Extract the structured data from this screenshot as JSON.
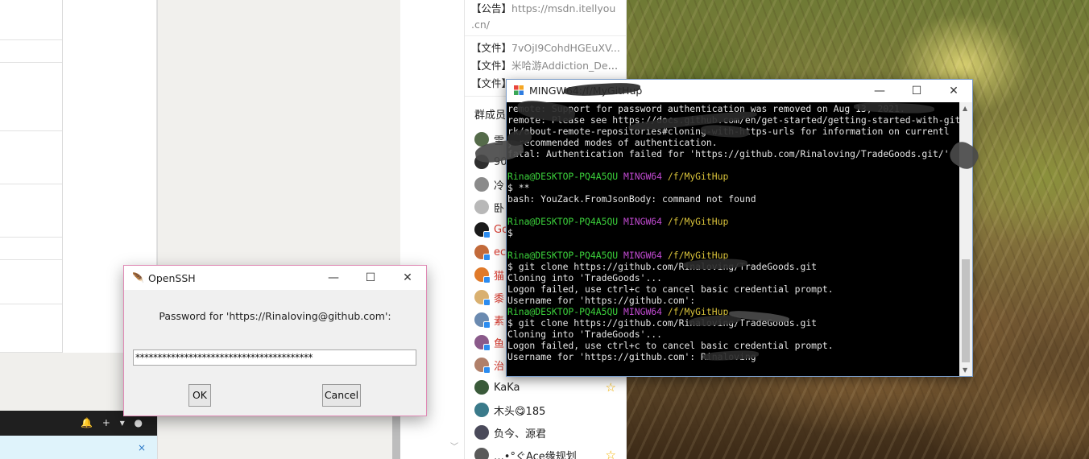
{
  "qq_panel": {
    "announcement": {
      "tag": "【公告】",
      "value": "https://msdn.itellyou",
      "cont": ".cn/"
    },
    "files": [
      {
        "tag": "【文件】",
        "value": "7vOjI9CohdHGEuXV..."
      },
      {
        "tag": "【文件】",
        "value": "米哈游Addiction_Dem..."
      },
      {
        "tag": "【文件】",
        "value": ""
      }
    ],
    "members_title": "群成员",
    "members": [
      {
        "name": "雪",
        "red": false,
        "color": "#556b4a",
        "dot": false,
        "star": false
      },
      {
        "name": "90",
        "red": false,
        "color": "#2e2e2e",
        "dot": false,
        "star": false
      },
      {
        "name": "冷",
        "red": false,
        "color": "#8a8a8a",
        "dot": false,
        "star": false
      },
      {
        "name": "卧",
        "red": false,
        "color": "#b8b8b8",
        "dot": false,
        "star": false
      },
      {
        "name": "Go",
        "red": true,
        "color": "#1a1a1a",
        "dot": true,
        "star": false
      },
      {
        "name": "ec",
        "red": true,
        "color": "#c26a3a",
        "dot": true,
        "star": false
      },
      {
        "name": "猫",
        "red": true,
        "color": "#e07a2a",
        "dot": true,
        "star": false
      },
      {
        "name": "黍",
        "red": true,
        "color": "#d9b070",
        "dot": true,
        "star": false
      },
      {
        "name": "素",
        "red": true,
        "color": "#6a8ab0",
        "dot": true,
        "star": false
      },
      {
        "name": "鱼",
        "red": true,
        "color": "#8a5a8a",
        "dot": true,
        "star": false
      },
      {
        "name": "治",
        "red": true,
        "color": "#b0806a",
        "dot": true,
        "star": false
      },
      {
        "name": "KaKa",
        "red": false,
        "color": "#3a5a3a",
        "dot": false,
        "star": true
      },
      {
        "name": "木头😋185",
        "red": false,
        "color": "#3a7a8a",
        "dot": false,
        "star": false
      },
      {
        "name": "负今、源君",
        "red": false,
        "color": "#4a4a5a",
        "dot": false,
        "star": false
      },
      {
        "name": "‥.•°ぐAce缘规划",
        "red": false,
        "color": "#5a5a5a",
        "dot": false,
        "star": true
      }
    ]
  },
  "terminal": {
    "title": "MINGW64:/f/MyGitHup",
    "controls": {
      "minimize": "—",
      "maximize": "☐",
      "close": "✕"
    },
    "lines": [
      {
        "segs": [
          {
            "t": "remote: Support for password authentication was removed on Aug 13, 2021.",
            "c": ""
          }
        ]
      },
      {
        "segs": [
          {
            "t": "remote: Please see https://docs.github.com/en/get-started/getting-started-with-git/about-remote-repositories#cloning-with-https-urls for information on currently",
            "c": ""
          }
        ]
      },
      {
        "segs": [
          {
            "t": "rk/about-remote-repositories#cloning-with-https-urls for information on currentl",
            "c": ""
          }
        ]
      },
      {
        "segs": [
          {
            "t": "y recommended modes of authentication.",
            "c": ""
          }
        ]
      },
      {
        "segs": [
          {
            "t": "fatal: Authentication failed for 'https://github.com/Rinaloving/TradeGoods.git/'",
            "c": ""
          }
        ]
      },
      {
        "segs": [
          {
            "t": "",
            "c": ""
          }
        ]
      },
      {
        "segs": [
          {
            "t": "Rina@DESKTOP-PQ4A5QU ",
            "c": "t-green"
          },
          {
            "t": "MINGW64 ",
            "c": "t-purple"
          },
          {
            "t": "/f/MyGitHup",
            "c": "t-yellow"
          }
        ]
      },
      {
        "segs": [
          {
            "t": "$ **",
            "c": ""
          }
        ]
      },
      {
        "segs": [
          {
            "t": "bash: YouZack.FromJsonBody: command not found",
            "c": ""
          }
        ]
      },
      {
        "segs": [
          {
            "t": "",
            "c": ""
          }
        ]
      },
      {
        "segs": [
          {
            "t": "Rina@DESKTOP-PQ4A5QU ",
            "c": "t-green"
          },
          {
            "t": "MINGW64 ",
            "c": "t-purple"
          },
          {
            "t": "/f/MyGitHup",
            "c": "t-yellow"
          }
        ]
      },
      {
        "segs": [
          {
            "t": "$",
            "c": ""
          }
        ]
      },
      {
        "segs": [
          {
            "t": "",
            "c": ""
          }
        ]
      },
      {
        "segs": [
          {
            "t": "Rina@DESKTOP-PQ4A5QU ",
            "c": "t-green"
          },
          {
            "t": "MINGW64 ",
            "c": "t-purple"
          },
          {
            "t": "/f/MyGitHup",
            "c": "t-yellow"
          }
        ]
      },
      {
        "segs": [
          {
            "t": "$ git clone https://github.com/Rinaloving/TradeGoods.git",
            "c": ""
          }
        ]
      },
      {
        "segs": [
          {
            "t": "Cloning into 'TradeGoods'...",
            "c": ""
          }
        ]
      },
      {
        "segs": [
          {
            "t": "Logon failed, use ctrl+c to cancel basic credential prompt.",
            "c": ""
          }
        ]
      },
      {
        "segs": [
          {
            "t": "Username for 'https://github.com':",
            "c": ""
          }
        ]
      },
      {
        "segs": [
          {
            "t": "Rina@DESKTOP-PQ4A5QU ",
            "c": "t-green"
          },
          {
            "t": "MINGW64 ",
            "c": "t-purple"
          },
          {
            "t": "/f/MyGitHup",
            "c": "t-yellow"
          }
        ]
      },
      {
        "segs": [
          {
            "t": "$ git clone https://github.com/Rinaloving/TradeGoods.git",
            "c": ""
          }
        ]
      },
      {
        "segs": [
          {
            "t": "Cloning into 'TradeGoods'...",
            "c": ""
          }
        ]
      },
      {
        "segs": [
          {
            "t": "Logon failed, use ctrl+c to cancel basic credential prompt.",
            "c": ""
          }
        ]
      },
      {
        "segs": [
          {
            "t": "Username for 'https://github.com': Rinaloving",
            "c": ""
          }
        ]
      }
    ]
  },
  "ssh_dialog": {
    "title": "OpenSSH",
    "prompt": "Password for 'https://Rinaloving@github.com':",
    "password_mask": "****************************************",
    "ok_label": "OK",
    "cancel_label": "Cancel",
    "controls": {
      "minimize": "—",
      "maximize": "☐",
      "close": "✕"
    }
  },
  "taskbar": {
    "icons": "🔔 + ▾ ●",
    "notice_close": "×"
  },
  "colors": {
    "terminal_bg": "#000000",
    "prompt_user": "#3bd13b",
    "prompt_host": "#c14ad1",
    "prompt_path": "#d8c23a",
    "dialog_border": "#e08ab5"
  }
}
